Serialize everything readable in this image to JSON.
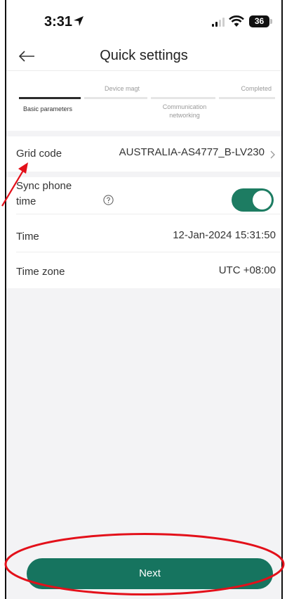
{
  "status_bar": {
    "time": "3:31",
    "battery": "36"
  },
  "header": {
    "title": "Quick settings"
  },
  "stepper": {
    "steps": [
      {
        "label": "Basic parameters",
        "state": "active"
      },
      {
        "label": "Device magt",
        "state": "pending"
      },
      {
        "label": "Communication networking",
        "state": "pending"
      },
      {
        "label": "Completed",
        "state": "pending"
      }
    ]
  },
  "settings": {
    "grid_code": {
      "label": "Grid code",
      "value": "AUSTRALIA-AS4777_B-LV230"
    },
    "sync_phone_time": {
      "label_line1": "Sync phone",
      "label_line2": "time",
      "enabled": true
    },
    "time": {
      "label": "Time",
      "value": "12-Jan-2024 15:31:50"
    },
    "time_zone": {
      "label": "Time zone",
      "value": "UTC +08:00"
    }
  },
  "footer": {
    "next_label": "Next"
  },
  "colors": {
    "accent": "#16745f",
    "toggle_on": "#1d7c62",
    "annotation": "#e3101a"
  }
}
